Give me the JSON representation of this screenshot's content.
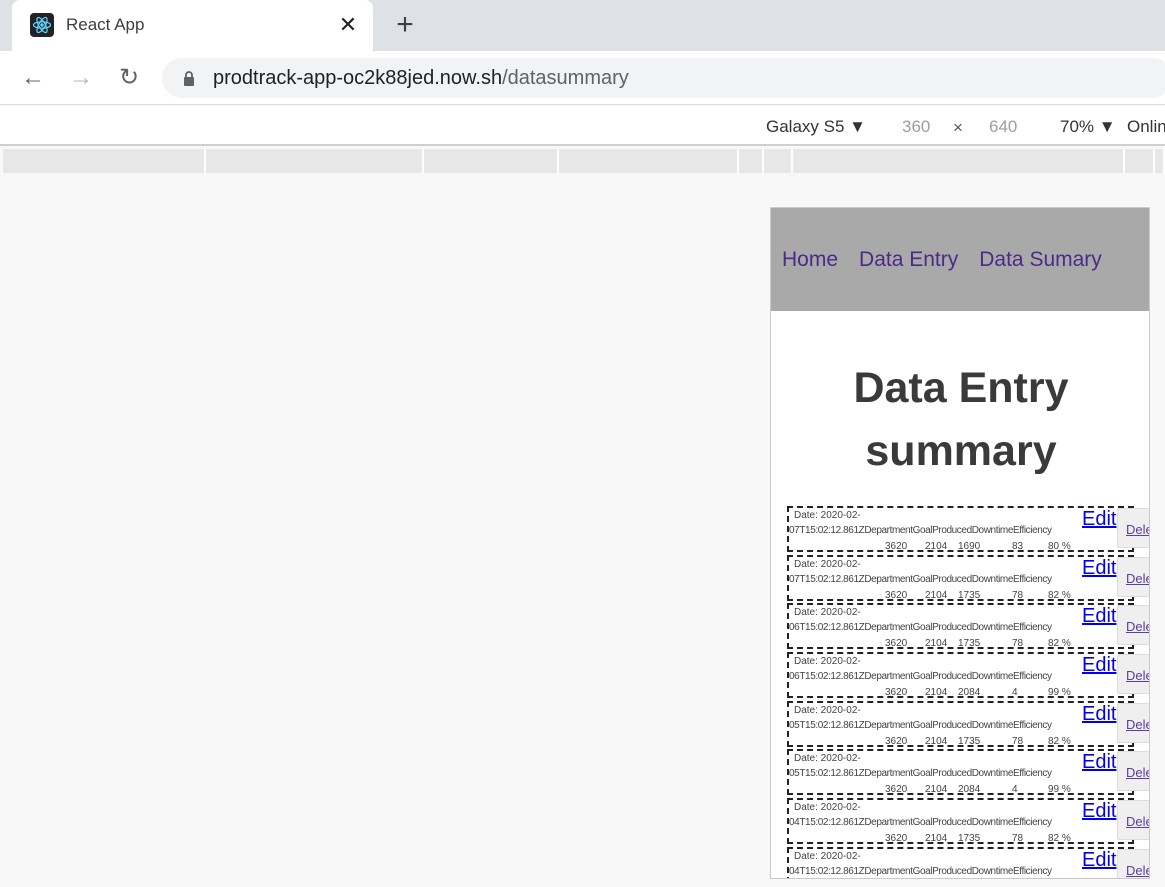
{
  "browser": {
    "tab_title": "React App",
    "tab_close": "✕",
    "new_tab": "+",
    "url_host": "prodtrack-app-oc2k88jed.now.sh",
    "url_path": "/datasummary"
  },
  "device_toolbar": {
    "device": "Galaxy S5",
    "width": "360",
    "times": "×",
    "height": "640",
    "zoom": "70%",
    "network": "Online"
  },
  "app": {
    "nav": [
      "Home",
      "Data Entry",
      "Data Sumary"
    ],
    "heading": "Data Entry summary",
    "edit_label": "Edit",
    "delete_label": "Dele",
    "entries": [
      {
        "date1": "Date: 2020-02-",
        "date2": "07T15:02:12.861Z",
        "dept": "3620",
        "goal": "2104",
        "produced": "1690",
        "downtime": "83",
        "efficiency": "80 %"
      },
      {
        "date1": "Date: 2020-02-",
        "date2": "07T15:02:12.861Z",
        "dept": "3620",
        "goal": "2104",
        "produced": "1735",
        "downtime": "78",
        "efficiency": "82 %"
      },
      {
        "date1": "Date: 2020-02-",
        "date2": "06T15:02:12.861Z",
        "dept": "3620",
        "goal": "2104",
        "produced": "1735",
        "downtime": "78",
        "efficiency": "82 %"
      },
      {
        "date1": "Date: 2020-02-",
        "date2": "06T15:02:12.861Z",
        "dept": "3620",
        "goal": "2104",
        "produced": "2084",
        "downtime": "4",
        "efficiency": "99 %"
      },
      {
        "date1": "Date: 2020-02-",
        "date2": "05T15:02:12.861Z",
        "dept": "3620",
        "goal": "2104",
        "produced": "1735",
        "downtime": "78",
        "efficiency": "82 %"
      },
      {
        "date1": "Date: 2020-02-",
        "date2": "05T15:02:12.861Z",
        "dept": "3620",
        "goal": "2104",
        "produced": "2084",
        "downtime": "4",
        "efficiency": "99 %"
      },
      {
        "date1": "Date: 2020-02-",
        "date2": "04T15:02:12.861Z",
        "dept": "3620",
        "goal": "2104",
        "produced": "1735",
        "downtime": "78",
        "efficiency": "82 %"
      },
      {
        "date1": "Date: 2020-02-",
        "date2": "04T15:02:12.861Z",
        "dept": "",
        "goal": "",
        "produced": "",
        "downtime": "",
        "efficiency": ""
      }
    ],
    "labels": {
      "department": "Department",
      "goal": "Goal",
      "produced": "Produced",
      "downtime": "Downtime",
      "efficiency": "Efficiency"
    }
  }
}
